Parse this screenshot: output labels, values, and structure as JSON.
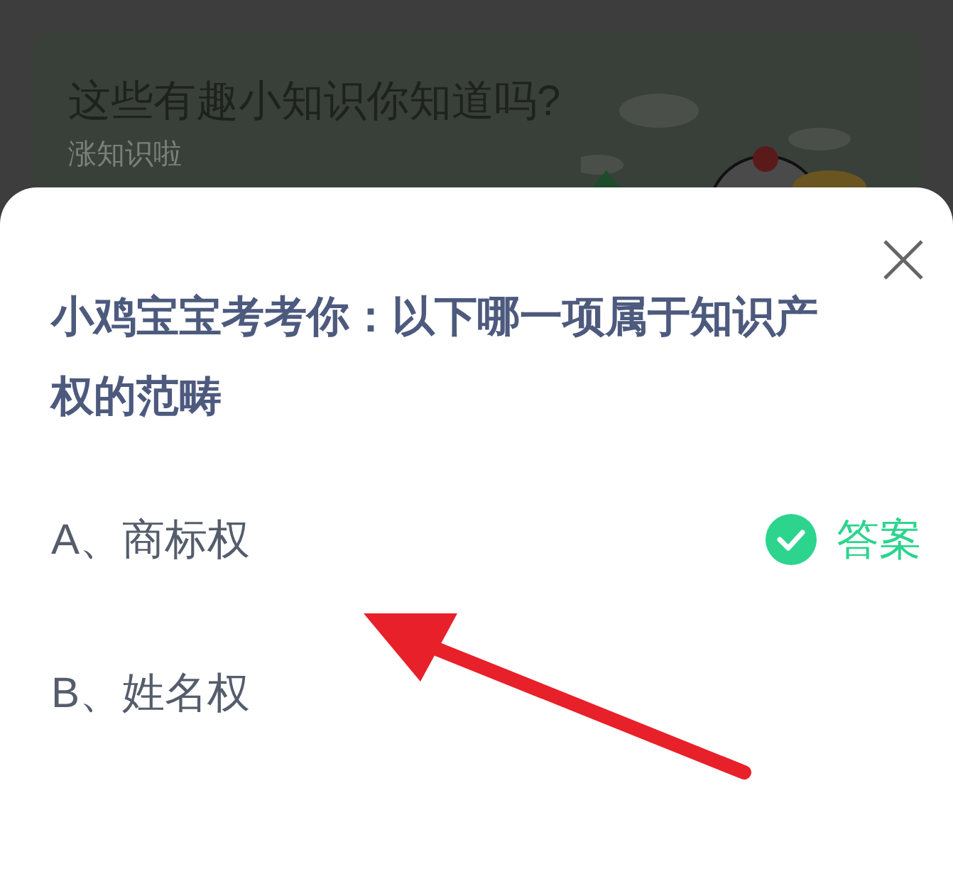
{
  "background_card": {
    "title": "这些有趣小知识你知道吗?",
    "subtitle": "涨知识啦"
  },
  "quiz": {
    "question": "小鸡宝宝考考你：以下哪一项属于知识产权的范畴",
    "answer_label": "答案",
    "options": [
      {
        "label": "A、商标权",
        "correct": true
      },
      {
        "label": "B、姓名权",
        "correct": false
      }
    ]
  }
}
